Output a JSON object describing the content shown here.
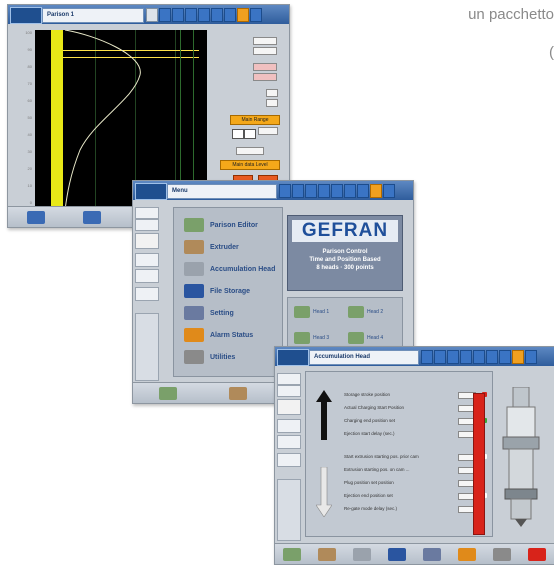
{
  "caption": {
    "line1": "un pacchetto",
    "line2": "("
  },
  "colors": {
    "accent_blue": "#3a74c4",
    "accent_orange": "#f4a81a",
    "plot_bar": "#e8e817",
    "alarm_red": "#d8231a"
  },
  "screen1": {
    "page_title": "Parison 1",
    "axis_ticks": [
      "100",
      "90",
      "80",
      "70",
      "60",
      "50",
      "40",
      "30",
      "20",
      "10",
      "0"
    ],
    "buttons": {
      "main": "Main Range",
      "secondary": "Main data Level"
    }
  },
  "screen2": {
    "page_title": "Menu",
    "menu": [
      {
        "label": "Parison Editor",
        "icon": "parison-icon",
        "color": "#7aa06a"
      },
      {
        "label": "Extruder",
        "icon": "extruder-icon",
        "color": "#b08a5a"
      },
      {
        "label": "Accumulation Head",
        "icon": "head-icon",
        "color": "#9aa2ac"
      },
      {
        "label": "File Storage",
        "icon": "storage-icon",
        "color": "#2a55a0"
      },
      {
        "label": "Setting",
        "icon": "settings-icon",
        "color": "#6a7aa0"
      },
      {
        "label": "Alarm Status",
        "icon": "alarm-icon",
        "color": "#e08a1a"
      },
      {
        "label": "Utilities",
        "icon": "utilities-icon",
        "color": "#8a8a8a"
      }
    ],
    "brand": {
      "logo": "GEFRAN",
      "line1": "Parison Control",
      "line2": "Time and Position Based",
      "line3": "8 heads · 300 points"
    },
    "heads": [
      "Head 1",
      "Head 2",
      "Head 3",
      "Head 4"
    ]
  },
  "screen3": {
    "page_title": "Accumulation Head",
    "rows": [
      "Storage stroke position",
      "Actual Charging Start Position",
      "Charging end position set",
      "Ejection start delay (sec.)",
      "Start extrusion starting pos. prior cam",
      "Extrusion starting pos. on cam ...",
      "Plug position set position",
      "Ejection end position set",
      "Re-gate mode delay (sec.)"
    ]
  }
}
